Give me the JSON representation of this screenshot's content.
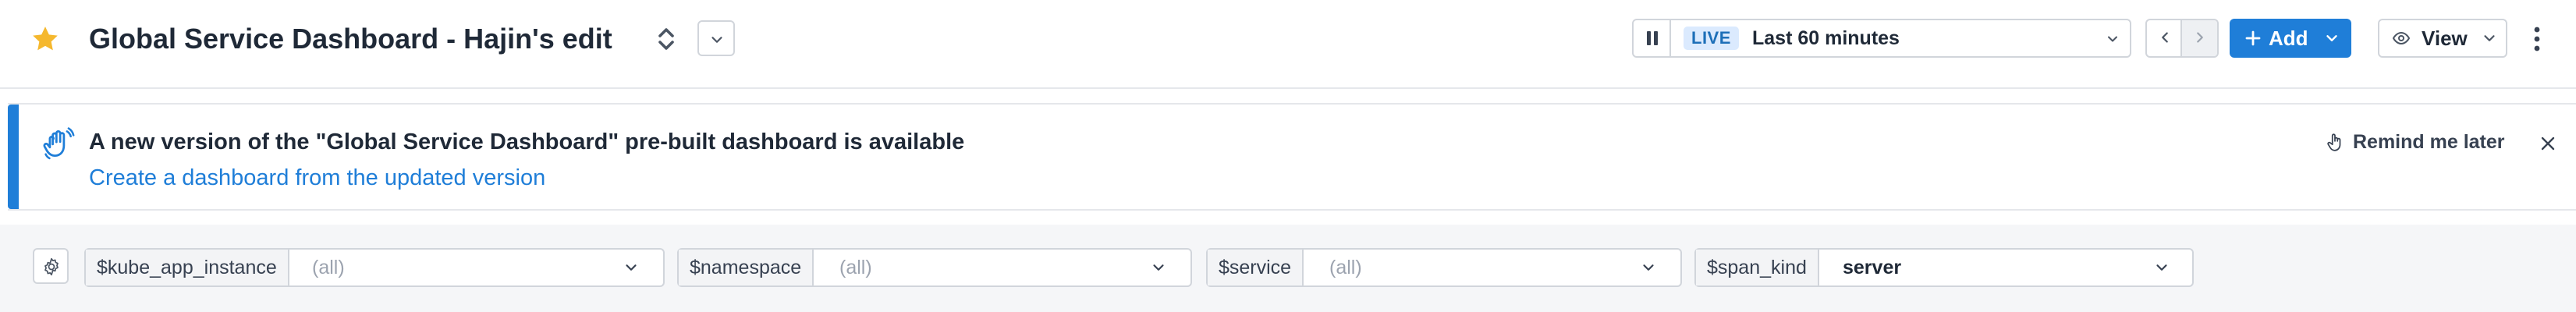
{
  "header": {
    "title": "Global Service Dashboard - Hajin's edit",
    "favorite_icon": "star-icon",
    "star_color": "#f5b82e"
  },
  "time_picker": {
    "live_label": "LIVE",
    "range_label": "Last 60 minutes"
  },
  "toolbar": {
    "add_label": "Add",
    "view_label": "View",
    "accent_color": "#1f7ed8"
  },
  "banner": {
    "title": "A new version of the \"Global Service Dashboard\" pre-built dashboard is available",
    "link_text": "Create a dashboard from the updated version",
    "remind_label": "Remind me later",
    "icon": "waving-hand-icon"
  },
  "variables": [
    {
      "label": "$kube_app_instance",
      "value": "(all)"
    },
    {
      "label": "$namespace",
      "value": "(all)"
    },
    {
      "label": "$service",
      "value": "(all)"
    },
    {
      "label": "$span_kind",
      "value": "server"
    }
  ]
}
